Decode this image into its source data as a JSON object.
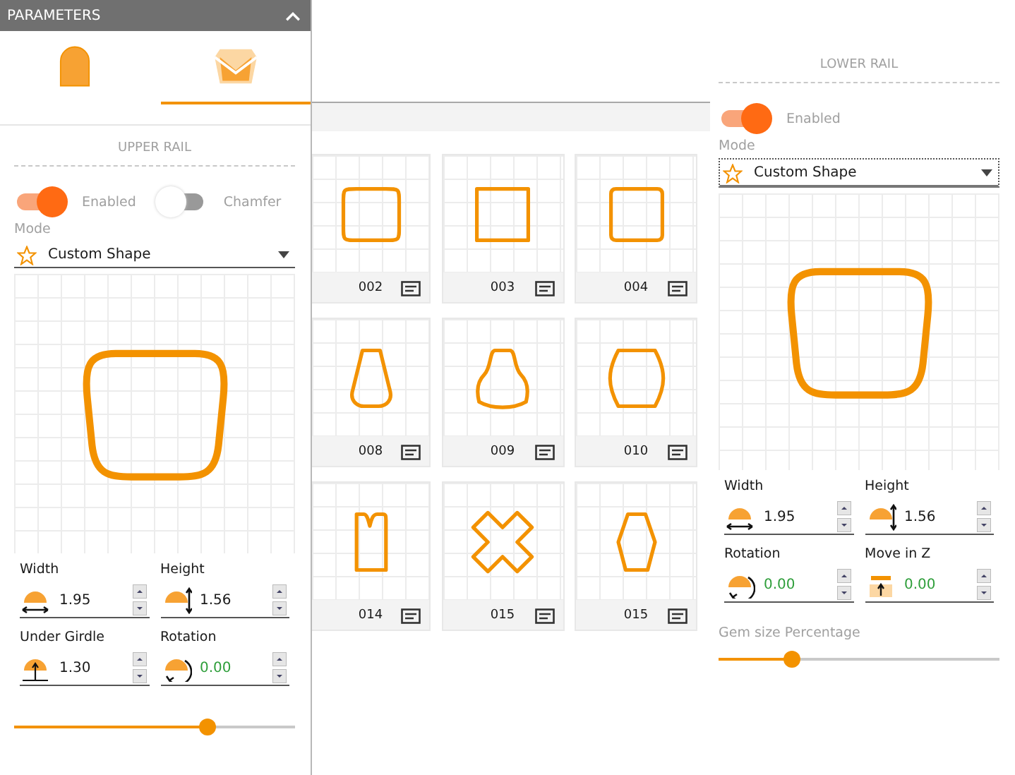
{
  "parameters_panel": {
    "title": "PARAMETERS",
    "tabs": [
      {
        "kind": "cabochon",
        "selected": false
      },
      {
        "kind": "faceted",
        "selected": true
      }
    ],
    "upper_rail": {
      "title": "UPPER RAIL",
      "toggles": [
        {
          "label": "Enabled",
          "on": true
        },
        {
          "label": "Chamfer",
          "on": false
        }
      ],
      "mode": {
        "label": "Mode",
        "value": "Custom Shape",
        "focused": false
      },
      "preview": {
        "kind": "rounded_trapezoid"
      },
      "fields": [
        {
          "kind": "width",
          "label": "Width",
          "value": "1.95",
          "color": "#1a1a1a"
        },
        {
          "kind": "height",
          "label": "Height",
          "value": "1.56",
          "color": "#1a1a1a"
        },
        {
          "kind": "under_girdle",
          "label": "Under Girdle",
          "value": "1.30",
          "color": "#1a1a1a"
        },
        {
          "kind": "rotation",
          "label": "Rotation",
          "value": "0.00",
          "color": "#2e9e3a"
        }
      ],
      "slider": {
        "level": 0.69
      }
    }
  },
  "shape_gallery": {
    "tiles": [
      {
        "label": "002",
        "kind": "squircle"
      },
      {
        "label": "003",
        "kind": "square"
      },
      {
        "label": "004",
        "kind": "rounded_square"
      },
      {
        "label": "008",
        "kind": "tapered"
      },
      {
        "label": "009",
        "kind": "bell"
      },
      {
        "label": "010",
        "kind": "barrel"
      },
      {
        "label": "014",
        "kind": "notched"
      },
      {
        "label": "015",
        "kind": "cross"
      },
      {
        "label": "015",
        "kind": "hexagon"
      }
    ]
  },
  "lower_rail": {
    "title": "LOWER RAIL",
    "toggles": [
      {
        "label": "Enabled",
        "on": true
      }
    ],
    "mode": {
      "label": "Mode",
      "value": "Custom Shape",
      "focused": true
    },
    "preview": {
      "kind": "rounded_trapezoid"
    },
    "fields": [
      {
        "kind": "width",
        "label": "Width",
        "value": "1.95",
        "color": "#1a1a1a"
      },
      {
        "kind": "height",
        "label": "Height",
        "value": "1.56",
        "color": "#1a1a1a"
      },
      {
        "kind": "rotation",
        "label": "Rotation",
        "value": "0.00",
        "color": "#2e9e3a"
      },
      {
        "kind": "move_z",
        "label": "Move in Z",
        "value": "0.00",
        "color": "#2e9e3a"
      }
    ],
    "slider": {
      "label": "Gem size Percentage",
      "level": 0.26
    }
  }
}
